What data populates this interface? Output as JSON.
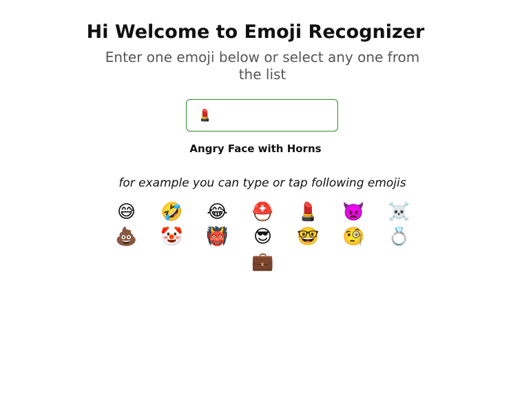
{
  "page": {
    "title": "Hi Welcome to Emoji Recognizer",
    "subtitle": "Enter one emoji below or select any one from the list"
  },
  "input": {
    "value": "💄",
    "placeholder": ""
  },
  "result": {
    "meaning": "Angry Face with Horns"
  },
  "hint": {
    "text": "for example you can type or tap following emojis"
  },
  "emojis": [
    {
      "glyph": "😅",
      "icon": "grinning-face-with-sweat-icon"
    },
    {
      "glyph": "🤣",
      "icon": "rolling-on-floor-laughing-icon"
    },
    {
      "glyph": "😂",
      "icon": "face-with-tears-of-joy-icon"
    },
    {
      "glyph": "⛑️",
      "icon": "rescue-helmet-icon"
    },
    {
      "glyph": "💄",
      "icon": "lipstick-icon"
    },
    {
      "glyph": "👿",
      "icon": "angry-face-with-horns-icon"
    },
    {
      "glyph": "☠️",
      "icon": "skull-and-crossbones-icon"
    },
    {
      "glyph": "💩",
      "icon": "pile-of-poo-icon"
    },
    {
      "glyph": "🤡",
      "icon": "clown-face-icon"
    },
    {
      "glyph": "👹",
      "icon": "ogre-icon"
    },
    {
      "glyph": "😎",
      "icon": "smiling-face-with-sunglasses-icon"
    },
    {
      "glyph": "🤓",
      "icon": "nerd-face-icon"
    },
    {
      "glyph": "🧐",
      "icon": "face-with-monocle-icon"
    },
    {
      "glyph": "💍",
      "icon": "ring-icon"
    },
    {
      "glyph": "💼",
      "icon": "briefcase-icon"
    }
  ],
  "colors": {
    "input_border": "#2e8b2e",
    "subtitle": "#555555",
    "text": "#111111"
  }
}
